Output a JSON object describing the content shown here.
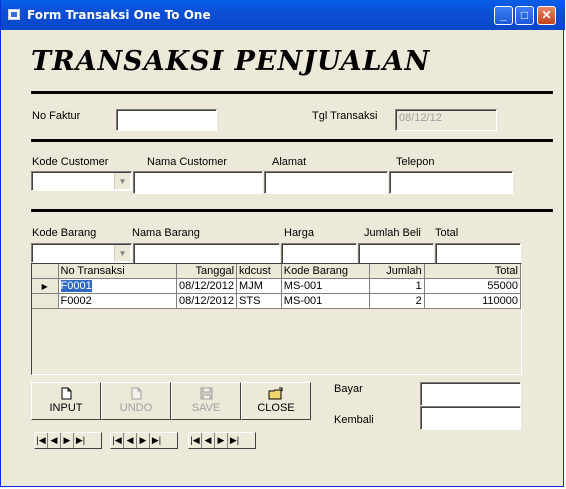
{
  "window": {
    "title": "Form Transaksi One To One"
  },
  "heading": "TRANSAKSI PENJUALAN",
  "faktur": {
    "label": "No Faktur",
    "value": ""
  },
  "tgl": {
    "label": "Tgl Transaksi",
    "value": "08/12/12"
  },
  "customer": {
    "kode_label": "Kode Customer",
    "kode_value": "",
    "nama_label": "Nama Customer",
    "nama_value": "",
    "alamat_label": "Alamat",
    "alamat_value": "",
    "telepon_label": "Telepon",
    "telepon_value": ""
  },
  "barang": {
    "kode_label": "Kode Barang",
    "kode_value": "",
    "nama_label": "Nama Barang",
    "nama_value": "",
    "harga_label": "Harga",
    "harga_value": "",
    "jumlah_label": "Jumlah Beli",
    "jumlah_value": "",
    "total_label": "Total",
    "total_value": ""
  },
  "grid": {
    "columns": [
      "No Transaksi",
      "Tanggal",
      "kdcust",
      "Kode Barang",
      "Jumlah",
      "Total"
    ],
    "rows": [
      [
        "F0001",
        "08/12/2012",
        "MJM",
        "MS-001",
        "1",
        "55000"
      ],
      [
        "F0002",
        "08/12/2012",
        "STS",
        "MS-001",
        "2",
        "110000"
      ]
    ],
    "current_marker": "▶"
  },
  "buttons": {
    "input": "INPUT",
    "undo": "UNDO",
    "save": "SAVE",
    "close": "CLOSE"
  },
  "bayar": {
    "label": "Bayar",
    "value": ""
  },
  "kembali": {
    "label": "Kembali",
    "value": ""
  },
  "icons": {
    "input": "new-document-icon",
    "undo": "undo-document-icon",
    "save": "floppy-disk-icon",
    "close": "exit-folder-icon"
  }
}
